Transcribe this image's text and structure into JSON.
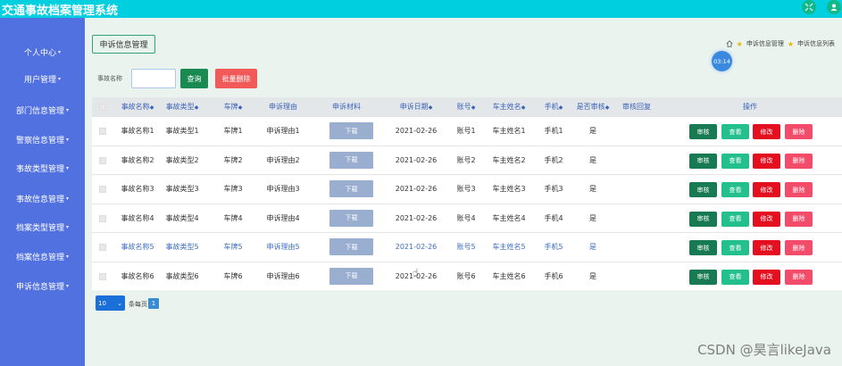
{
  "app": {
    "title": "交通事故档案管理系统"
  },
  "top_icons": [
    {
      "name": "fullscreen-icon"
    },
    {
      "name": "user-icon"
    }
  ],
  "sidebar": {
    "items": [
      {
        "label": "个人中心"
      },
      {
        "label": "用户管理"
      },
      {
        "label": "部门信息管理"
      },
      {
        "label": "警察信息管理"
      },
      {
        "label": "事故类型管理"
      },
      {
        "label": "事故信息管理"
      },
      {
        "label": "档案类型管理"
      },
      {
        "label": "档案信息管理"
      },
      {
        "label": "申诉信息管理"
      }
    ]
  },
  "main": {
    "tab_label": "申诉信息管理",
    "breadcrumb": {
      "item1": "申诉信息管理",
      "item2": "申诉信息列表"
    },
    "clock": "03:14",
    "search": {
      "label": "事故名称",
      "value": "",
      "query_label": "查询",
      "batch_delete_label": "批量删除"
    }
  },
  "table": {
    "headers": [
      "事故名称",
      "事故类型",
      "车牌",
      "申诉理由",
      "申诉材料",
      "申诉日期",
      "账号",
      "车主姓名",
      "手机",
      "是否审核",
      "审核回复",
      "操作"
    ],
    "sort_mark": "◆",
    "download_label": "下载",
    "actions": {
      "audit": "审核",
      "view": "查看",
      "edit": "修改",
      "delete": "删除"
    },
    "rows": [
      [
        "事故名称1",
        "事故类型1",
        "车牌1",
        "申诉理由1",
        "2021-02-26",
        "账号1",
        "车主姓名1",
        "手机1",
        "是"
      ],
      [
        "事故名称2",
        "事故类型2",
        "车牌2",
        "申诉理由2",
        "2021-02-26",
        "账号2",
        "车主姓名2",
        "手机2",
        "是"
      ],
      [
        "事故名称3",
        "事故类型3",
        "车牌3",
        "申诉理由3",
        "2021-02-26",
        "账号3",
        "车主姓名3",
        "手机3",
        "是"
      ],
      [
        "事故名称4",
        "事故类型4",
        "车牌4",
        "申诉理由4",
        "2021-02-26",
        "账号4",
        "车主姓名4",
        "手机4",
        "是"
      ],
      [
        "事故名称5",
        "事故类型5",
        "车牌5",
        "申诉理由5",
        "2021-02-26",
        "账号5",
        "车主姓名5",
        "手机5",
        "是"
      ],
      [
        "事故名称6",
        "事故类型6",
        "车牌6",
        "申诉理由6",
        "2021-02-26",
        "账号6",
        "车主姓名6",
        "手机6",
        "是"
      ]
    ]
  },
  "pagination": {
    "page_size": "10",
    "page_size_label": "条每页",
    "current_page": "1"
  },
  "watermark": "CSDN @昊言likeJava",
  "colors": {
    "topbar": "#00cfe0",
    "sidebar": "#5271e0",
    "audit": "#187a52",
    "view": "#23c08e",
    "edit": "#e4101f",
    "delete": "#f24c6a"
  }
}
